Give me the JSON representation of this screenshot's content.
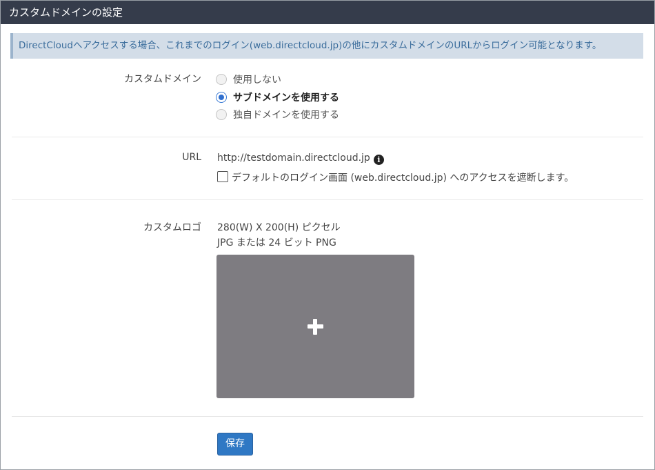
{
  "header": {
    "title": "カスタムドメインの設定"
  },
  "notice": {
    "text": "DirectCloudへアクセスする場合、これまでのログイン(web.directcloud.jp)の他にカスタムドメインのURLからログイン可能となります。"
  },
  "custom_domain": {
    "label": "カスタムドメイン",
    "options": [
      {
        "label": "使用しない",
        "selected": false
      },
      {
        "label": "サブドメインを使用する",
        "selected": true
      },
      {
        "label": "独自ドメインを使用する",
        "selected": false
      }
    ]
  },
  "url": {
    "label": "URL",
    "value": "http://testdomain.directcloud.jp",
    "info_icon": "info-icon",
    "block_default_checked": false,
    "block_default_label": "デフォルトのログイン画面 (web.directcloud.jp) へのアクセスを遮断します。"
  },
  "custom_logo": {
    "label": "カスタムロゴ",
    "size_hint": "280(W) X 200(H) ピクセル",
    "format_hint": "JPG または 24 ビット PNG",
    "upload_icon": "plus-icon"
  },
  "actions": {
    "save_label": "保存"
  },
  "colors": {
    "header_bg": "#353c4b",
    "notice_bg": "#d3dde8",
    "notice_text": "#3b6d9c",
    "accent": "#2f78c4",
    "logo_placeholder": "#7e7c81"
  }
}
